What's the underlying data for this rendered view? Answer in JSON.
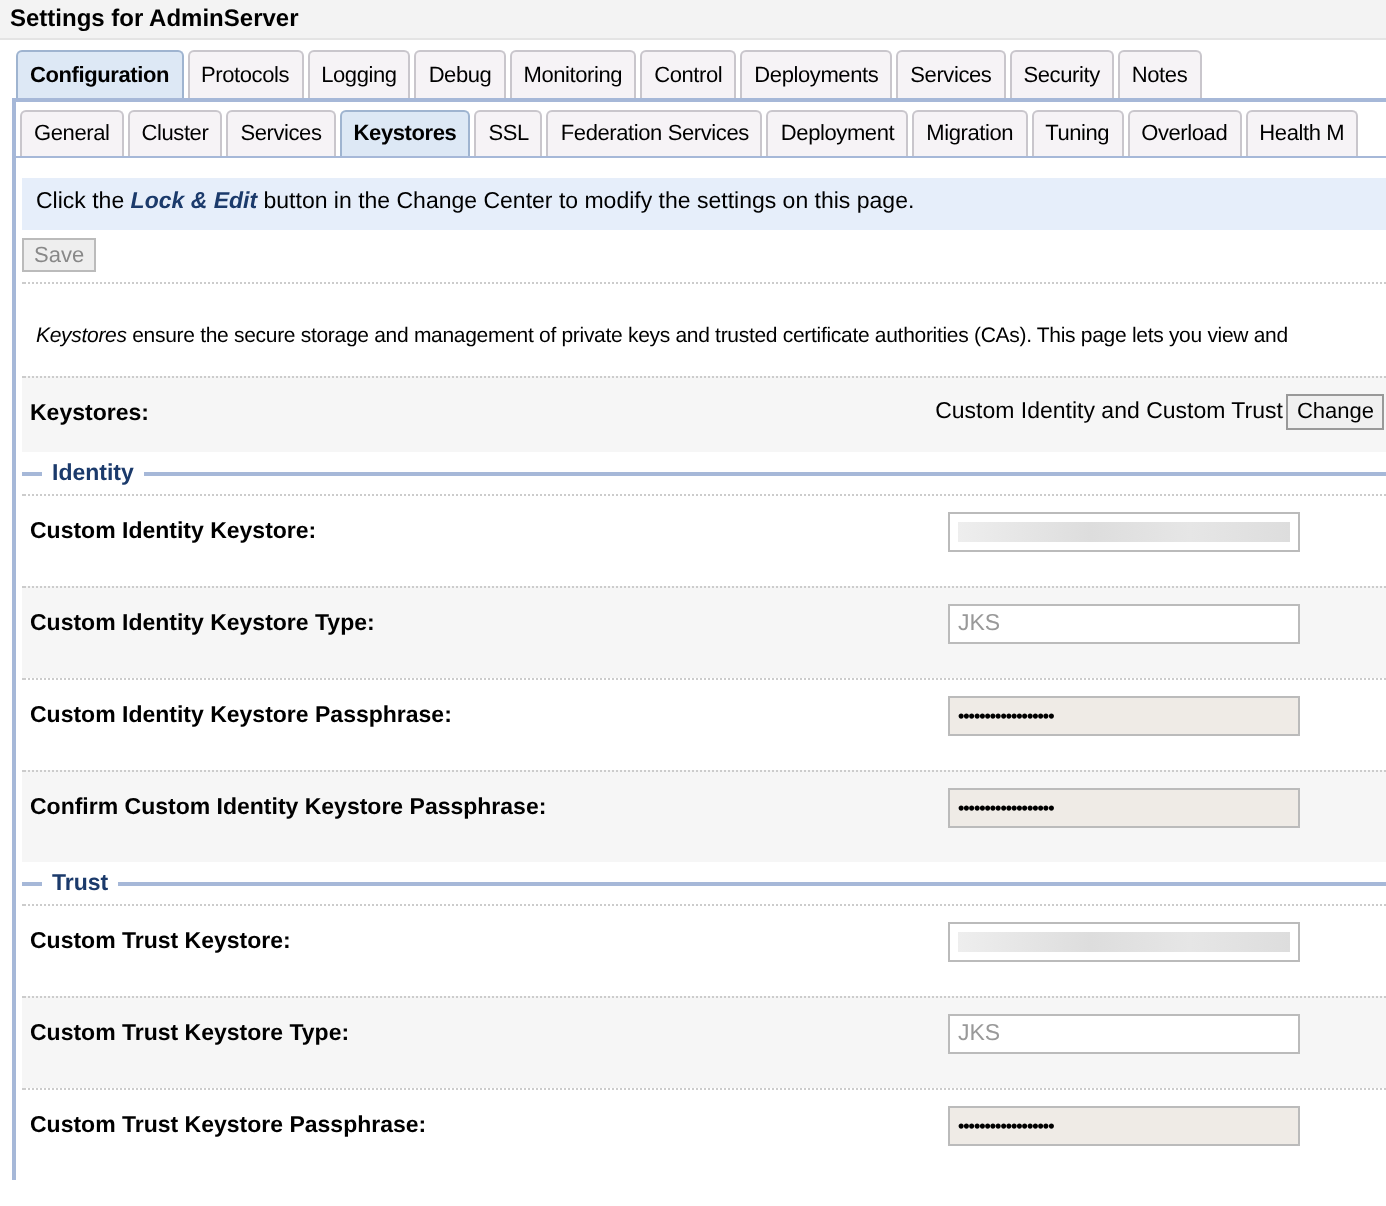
{
  "title": "Settings for AdminServer",
  "tabs": [
    {
      "label": "Configuration",
      "selected": true
    },
    {
      "label": "Protocols",
      "selected": false
    },
    {
      "label": "Logging",
      "selected": false
    },
    {
      "label": "Debug",
      "selected": false
    },
    {
      "label": "Monitoring",
      "selected": false
    },
    {
      "label": "Control",
      "selected": false
    },
    {
      "label": "Deployments",
      "selected": false
    },
    {
      "label": "Services",
      "selected": false
    },
    {
      "label": "Security",
      "selected": false
    },
    {
      "label": "Notes",
      "selected": false
    }
  ],
  "subtabs": [
    {
      "label": "General",
      "selected": false
    },
    {
      "label": "Cluster",
      "selected": false
    },
    {
      "label": "Services",
      "selected": false
    },
    {
      "label": "Keystores",
      "selected": true
    },
    {
      "label": "SSL",
      "selected": false
    },
    {
      "label": "Federation Services",
      "selected": false
    },
    {
      "label": "Deployment",
      "selected": false
    },
    {
      "label": "Migration",
      "selected": false
    },
    {
      "label": "Tuning",
      "selected": false
    },
    {
      "label": "Overload",
      "selected": false
    },
    {
      "label": "Health M",
      "selected": false
    }
  ],
  "info_message": "Click the **Lock & Edit** button in the Change Center to modify the settings on this page.",
  "save_button": {
    "label": "Save",
    "disabled": true
  },
  "description": "*Keystores* ensure the secure storage and management of private keys and trusted certificate authorities (CAs). This page lets you view and",
  "keystores": {
    "label": "Keystores:",
    "value": "Custom Identity and Custom Trust",
    "button": "Change"
  },
  "sections": [
    {
      "title": "Identity",
      "fields": [
        {
          "label": "Custom Identity Keystore:",
          "kind": "redacted"
        },
        {
          "label": "Custom Identity Keystore Type:",
          "kind": "text",
          "value": "JKS",
          "disabled": true
        },
        {
          "label": "Custom Identity Keystore Passphrase:",
          "kind": "password",
          "value": "••••••••••••••••••"
        },
        {
          "label": "Confirm Custom Identity Keystore Passphrase:",
          "kind": "password",
          "value": "••••••••••••••••••"
        }
      ]
    },
    {
      "title": "Trust",
      "fields": [
        {
          "label": "Custom Trust Keystore:",
          "kind": "redacted"
        },
        {
          "label": "Custom Trust Keystore Type:",
          "kind": "text",
          "value": "JKS",
          "disabled": true
        },
        {
          "label": "Custom Trust Keystore Passphrase:",
          "kind": "password",
          "value": "••••••••••••••••••"
        }
      ]
    }
  ]
}
